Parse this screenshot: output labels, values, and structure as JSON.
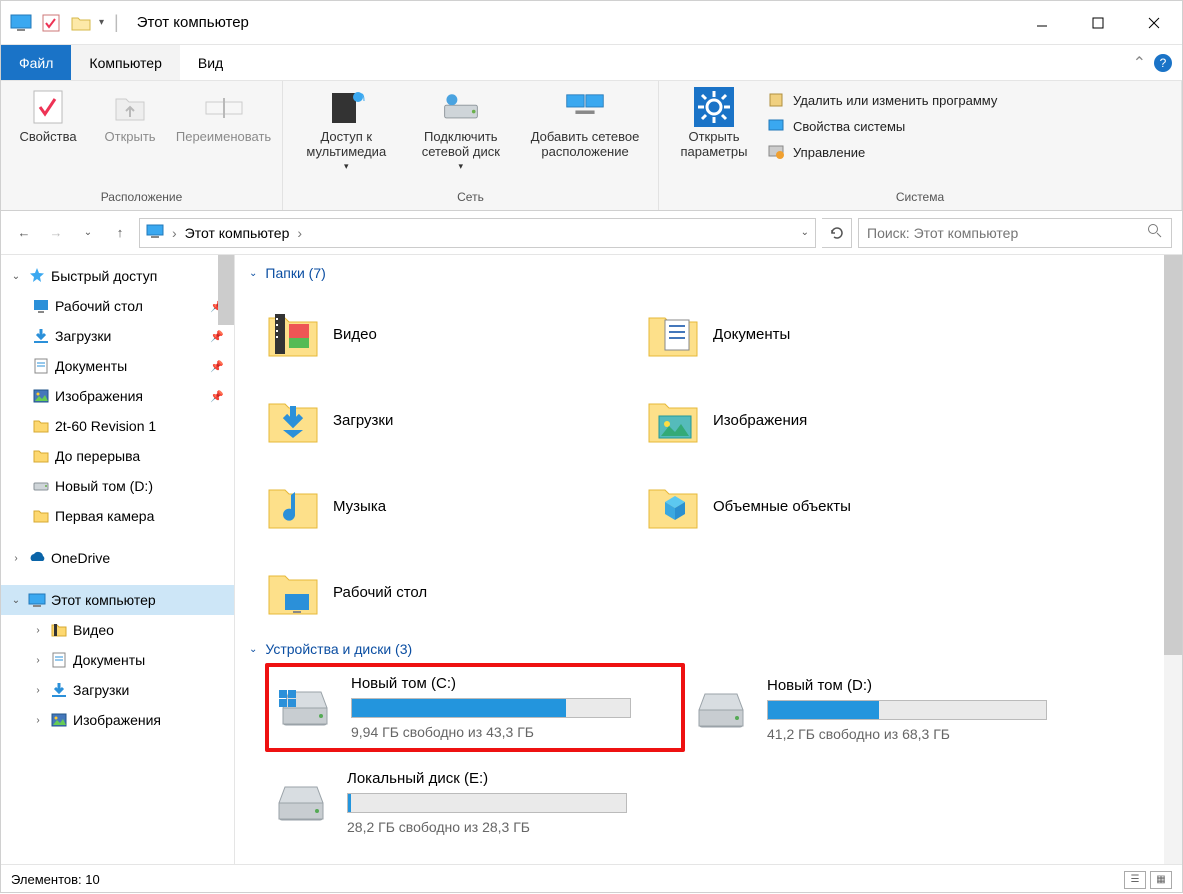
{
  "window": {
    "title": "Этот компьютер"
  },
  "ribbon": {
    "file": "Файл",
    "tabs": [
      {
        "label": "Компьютер",
        "active": true
      },
      {
        "label": "Вид",
        "active": false
      }
    ],
    "groups": {
      "location": {
        "label": "Расположение",
        "buttons": [
          {
            "name": "properties",
            "label": "Свойства"
          },
          {
            "name": "open",
            "label": "Открыть"
          },
          {
            "name": "rename",
            "label": "Переименовать"
          }
        ]
      },
      "network": {
        "label": "Сеть",
        "buttons": [
          {
            "name": "media-access",
            "label": "Доступ к мультимедиа"
          },
          {
            "name": "map-drive",
            "label": "Подключить сетевой диск"
          },
          {
            "name": "add-network-loc",
            "label": "Добавить сетевое расположение"
          }
        ]
      },
      "system": {
        "label": "Система",
        "settings_btn": "Открыть параметры",
        "links": [
          "Удалить или изменить программу",
          "Свойства системы",
          "Управление"
        ]
      }
    }
  },
  "nav": {
    "breadcrumb": "Этот компьютер",
    "search_placeholder": "Поиск: Этот компьютер"
  },
  "sidebar": {
    "quick_access": "Быстрый доступ",
    "quick_items": [
      {
        "label": "Рабочий стол",
        "pinned": true,
        "icon": "desktop"
      },
      {
        "label": "Загрузки",
        "pinned": true,
        "icon": "downloads"
      },
      {
        "label": "Документы",
        "pinned": true,
        "icon": "documents"
      },
      {
        "label": "Изображения",
        "pinned": true,
        "icon": "pictures"
      },
      {
        "label": "2t-60 Revision 1",
        "pinned": false,
        "icon": "folder"
      },
      {
        "label": "До перерыва",
        "pinned": false,
        "icon": "folder"
      },
      {
        "label": "Новый том (D:)",
        "pinned": false,
        "icon": "drive"
      },
      {
        "label": "Первая камера",
        "pinned": false,
        "icon": "folder"
      }
    ],
    "onedrive": "OneDrive",
    "this_pc": "Этот компьютер",
    "this_pc_items": [
      {
        "label": "Видео",
        "icon": "video"
      },
      {
        "label": "Документы",
        "icon": "documents"
      },
      {
        "label": "Загрузки",
        "icon": "downloads"
      },
      {
        "label": "Изображения",
        "icon": "pictures"
      }
    ]
  },
  "content": {
    "folders_header": "Папки (7)",
    "folders": [
      {
        "label": "Видео",
        "icon": "video"
      },
      {
        "label": "Документы",
        "icon": "documents"
      },
      {
        "label": "Загрузки",
        "icon": "downloads"
      },
      {
        "label": "Изображения",
        "icon": "pictures"
      },
      {
        "label": "Музыка",
        "icon": "music"
      },
      {
        "label": "Объемные объекты",
        "icon": "3d"
      },
      {
        "label": "Рабочий стол",
        "icon": "desktop"
      }
    ],
    "drives_header": "Устройства и диски (3)",
    "drives": [
      {
        "name": "Новый том (C:)",
        "free_text": "9,94 ГБ свободно из 43,3 ГБ",
        "percent": 77,
        "highlight": true,
        "os": true
      },
      {
        "name": "Новый том (D:)",
        "free_text": "41,2 ГБ свободно из 68,3 ГБ",
        "percent": 40,
        "highlight": false,
        "os": false
      },
      {
        "name": "Локальный диск (E:)",
        "free_text": "28,2 ГБ свободно из 28,3 ГБ",
        "percent": 1,
        "highlight": false,
        "os": false
      }
    ]
  },
  "status": {
    "items": "Элементов: 10"
  }
}
